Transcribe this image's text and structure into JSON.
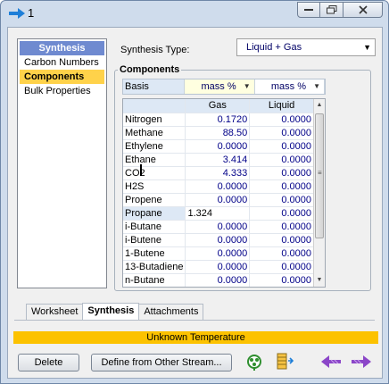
{
  "window": {
    "title": "1"
  },
  "nav": {
    "header": "Synthesis",
    "items": [
      {
        "label": "Carbon Numbers",
        "selected": false
      },
      {
        "label": "Components",
        "selected": true
      },
      {
        "label": "Bulk Properties",
        "selected": false
      }
    ]
  },
  "synthesis": {
    "type_label": "Synthesis Type:",
    "type_value": "Liquid + Gas"
  },
  "components": {
    "title": "Components",
    "basis": {
      "label": "Basis",
      "gas": "mass %",
      "liquid": "mass %"
    },
    "columns": {
      "gas": "Gas",
      "liquid": "Liquid"
    },
    "rows": [
      {
        "name": "Nitrogen",
        "gas": "0.1720",
        "liquid": "0.0000"
      },
      {
        "name": "Methane",
        "gas": "88.50",
        "liquid": "0.0000"
      },
      {
        "name": "Ethylene",
        "gas": "0.0000",
        "liquid": "0.0000"
      },
      {
        "name": "Ethane",
        "gas": "3.414",
        "liquid": "0.0000"
      },
      {
        "name": "CO2",
        "gas": "4.333",
        "liquid": "0.0000"
      },
      {
        "name": "H2S",
        "gas": "0.0000",
        "liquid": "0.0000"
      },
      {
        "name": "Propene",
        "gas": "0.0000",
        "liquid": "0.0000"
      },
      {
        "name": "Propane",
        "gas": "1.324",
        "liquid": "0.0000"
      },
      {
        "name": "i-Butane",
        "gas": "0.0000",
        "liquid": "0.0000"
      },
      {
        "name": "i-Butene",
        "gas": "0.0000",
        "liquid": "0.0000"
      },
      {
        "name": "1-Butene",
        "gas": "0.0000",
        "liquid": "0.0000"
      },
      {
        "name": "13-Butadiene",
        "gas": "0.0000",
        "liquid": "0.0000"
      },
      {
        "name": "n-Butane",
        "gas": "0.0000",
        "liquid": "0.0000"
      }
    ]
  },
  "tabs": [
    {
      "label": "Worksheet",
      "selected": false
    },
    {
      "label": "Synthesis",
      "selected": true
    },
    {
      "label": "Attachments",
      "selected": false
    }
  ],
  "status": {
    "text": "Unknown Temperature",
    "color": "#fcc200"
  },
  "buttons": {
    "delete": "Delete",
    "define": "Define from Other Stream..."
  },
  "icons": {
    "title": "stream-arrow-icon",
    "stream": "molecule-icon",
    "table": "table-icon",
    "prev": "arrow-left-icon",
    "next": "arrow-right-icon"
  },
  "colors": {
    "accent": "#6f8ad0",
    "selected": "#ffd24a",
    "value": "#000088"
  }
}
